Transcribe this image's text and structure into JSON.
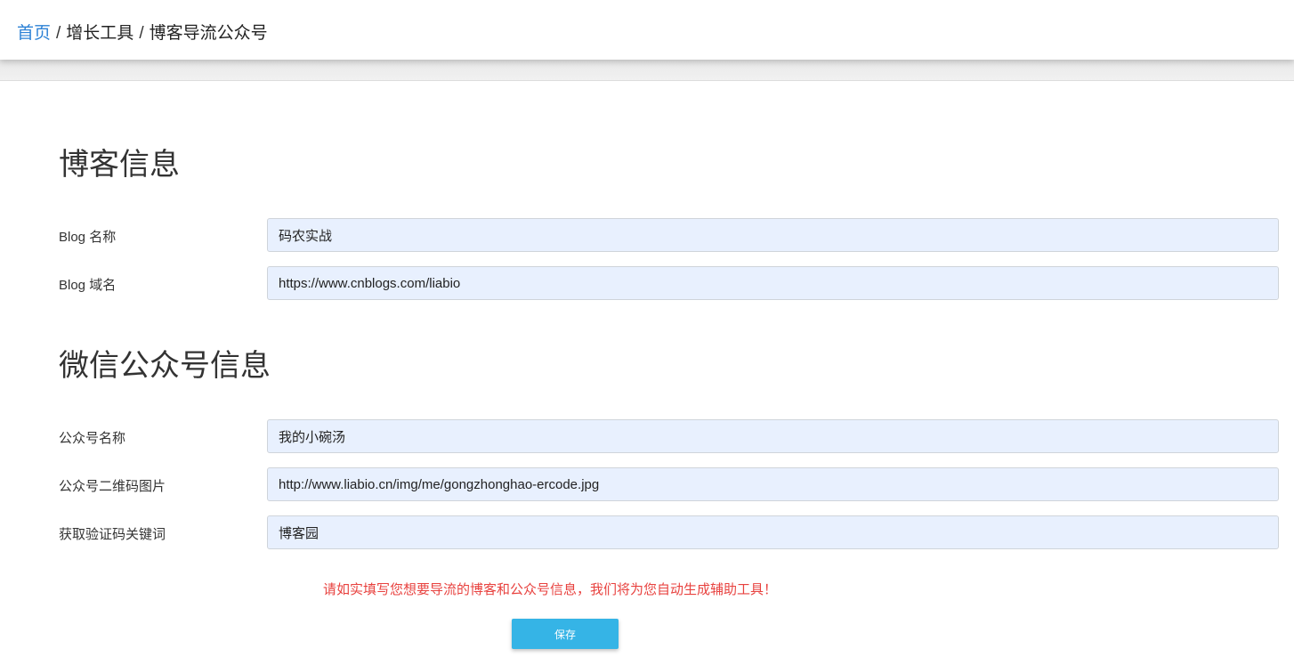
{
  "breadcrumb": {
    "home": "首页",
    "separator": "/",
    "level2": "增长工具",
    "current": "博客导流公众号"
  },
  "blog_section": {
    "title": "博客信息",
    "name_label": "Blog 名称",
    "name_value": "码农实战",
    "domain_label": "Blog 域名",
    "domain_value": "https://www.cnblogs.com/liabio"
  },
  "wechat_section": {
    "title": "微信公众号信息",
    "name_label": "公众号名称",
    "name_value": "我的小碗汤",
    "qrcode_label": "公众号二维码图片",
    "qrcode_value": "http://www.liabio.cn/img/me/gongzhonghao-ercode.jpg",
    "keyword_label": "获取验证码关键词",
    "keyword_value": "博客园"
  },
  "notice": "请如实填写您想要导流的博客和公众号信息，我们将为您自动生成辅助工具！",
  "save_label": "保存",
  "colors": {
    "link": "#2d82d6",
    "notice": "#e8423f",
    "button": "#35b4e6",
    "input_bg": "#e8f0fe"
  }
}
